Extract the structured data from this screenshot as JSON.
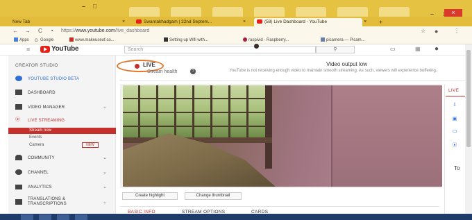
{
  "browser": {
    "tabs": [
      {
        "label": "New Tab"
      },
      {
        "label": "Swarnakhadgam | 22nd Septem..."
      },
      {
        "label": "(58) Live Dashboard - YouTube"
      }
    ],
    "url_prefix": "https://",
    "url_host": "www.youtube.com",
    "url_path": "/live_dashboard",
    "bookmarks": [
      {
        "label": "Apps"
      },
      {
        "label": "Google"
      },
      {
        "label": "www.makeuseof.co..."
      },
      {
        "label": "Setting up Wifi with..."
      },
      {
        "label": "raspivid - Raspberry..."
      },
      {
        "label": "picamera — Picam..."
      }
    ],
    "win_minimize": "–",
    "win_maximize": "□",
    "win_close": "×"
  },
  "masthead": {
    "logo": "YouTube",
    "search_placeholder": "Search",
    "search_button": "⚲"
  },
  "sidebar": {
    "title": "CREATOR STUDIO",
    "items": [
      {
        "label": "YOUTUBE STUDIO BETA"
      },
      {
        "label": "DASHBOARD"
      },
      {
        "label": "VIDEO MANAGER"
      },
      {
        "label": "LIVE STREAMING"
      },
      {
        "label": "COMMUNITY"
      },
      {
        "label": "CHANNEL"
      },
      {
        "label": "ANALYTICS"
      },
      {
        "label": "TRANSLATIONS & TRANSCRIPTIONS"
      }
    ],
    "live_sub": {
      "stream_now": "Stream now",
      "events": "Events",
      "camera": "Camera",
      "new_badge": "NEW"
    }
  },
  "live_header": {
    "status": "LIVE",
    "stream_health": "Stream health",
    "warning_title": "Video output low",
    "warning_body": "YouTube is not receiving enough video to maintain smooth streaming. As such, viewers will experience buffering."
  },
  "video_actions": {
    "create_highlight": "Create highlight",
    "change_thumbnail": "Change thumbnail"
  },
  "bottom_tabs": [
    {
      "label": "BASIC INFO"
    },
    {
      "label": "STREAM OPTIONS"
    },
    {
      "label": "CARDS"
    }
  ],
  "right_panel": {
    "tab_live": "LIVE",
    "to_label": "To"
  },
  "colors": {
    "accent": "#c4302b",
    "chrome": "#e6c243",
    "annotation_oval": "#e5762a"
  }
}
